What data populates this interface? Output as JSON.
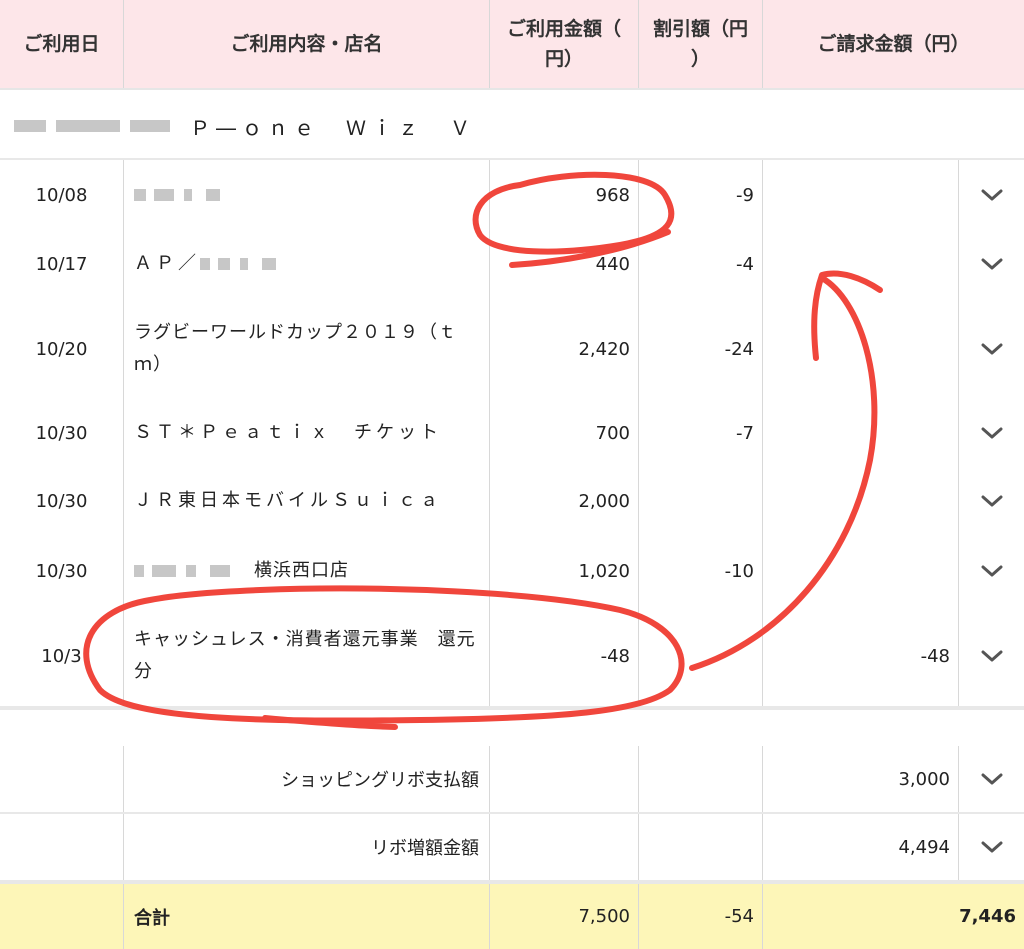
{
  "header": {
    "date": "ご利用日",
    "content": "ご利用内容・店名",
    "amount_line1": "ご利用金額（",
    "amount_line2": "円）",
    "discount_line1": "割引額（円",
    "discount_line2": "）",
    "billed": "ご請求金額（円）"
  },
  "card": {
    "name": "Ｐ―ｏｎｅ　Ｗｉｚ　Ｖ"
  },
  "rows": [
    {
      "date": "10/08",
      "desc": "",
      "amount": "968",
      "discount": "-9",
      "billed": ""
    },
    {
      "date": "10/17",
      "desc": "ＡＰ／",
      "amount": "440",
      "discount": "-4",
      "billed": ""
    },
    {
      "date": "10/20",
      "desc": "ラグビーワールドカップ２０１９（ｔｍ）",
      "amount": "2,420",
      "discount": "-24",
      "billed": ""
    },
    {
      "date": "10/30",
      "desc": "ＳＴ＊Ｐｅａｔｉｘ　チケット",
      "amount": "700",
      "discount": "-7",
      "billed": ""
    },
    {
      "date": "10/30",
      "desc": "ＪＲ東日本モバイルＳｕｉｃａ",
      "amount": "2,000",
      "discount": "",
      "billed": ""
    },
    {
      "date": "10/30",
      "desc": "横浜西口店",
      "amount": "1,020",
      "discount": "-10",
      "billed": ""
    },
    {
      "date": "10/3",
      "desc": "キャッシュレス・消費者還元事業　還元分",
      "amount": "-48",
      "discount": "",
      "billed": "-48"
    }
  ],
  "summary": [
    {
      "label": "ショッピングリボ支払額",
      "billed": "3,000"
    },
    {
      "label": "リボ増額金額",
      "billed": "4,494"
    }
  ],
  "total": {
    "label": "合計",
    "amount": "7,500",
    "discount": "-54",
    "billed": "7,446"
  },
  "colors": {
    "header_bg": "#fde6e9",
    "total_bg": "#fdf6b8",
    "annotation": "#f0463c"
  },
  "icons": {
    "expand": "chevron-down-icon"
  }
}
